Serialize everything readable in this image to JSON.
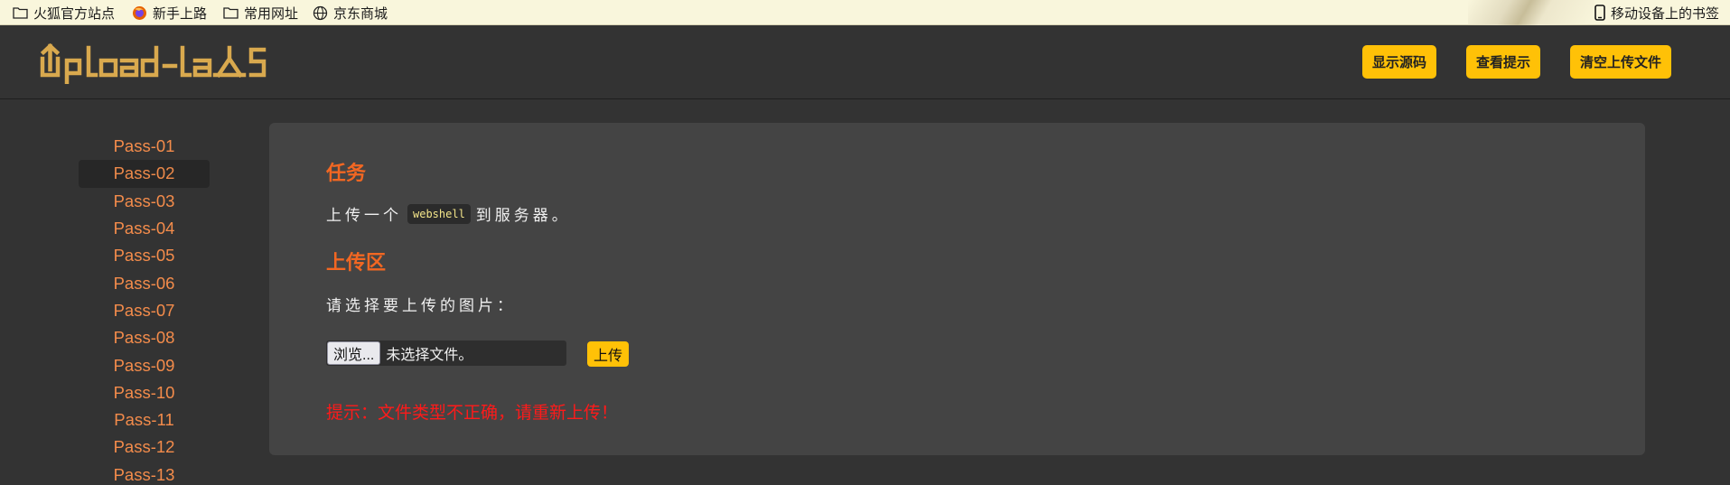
{
  "bookmarks": {
    "items": [
      {
        "label": "火狐官方站点",
        "icon": "folder-icon"
      },
      {
        "label": "新手上路",
        "icon": "firefox-icon"
      },
      {
        "label": "常用网址",
        "icon": "folder-icon"
      },
      {
        "label": "京东商城",
        "icon": "globe-icon"
      }
    ],
    "mobile": {
      "label": "移动设备上的书签",
      "icon": "mobile-icon"
    }
  },
  "header": {
    "logo_text": "Upload-labs",
    "buttons": {
      "show_source": "显示源码",
      "show_hint": "查看提示",
      "clear_uploads": "清空上传文件"
    }
  },
  "sidebar": {
    "items": [
      "Pass-01",
      "Pass-02",
      "Pass-03",
      "Pass-04",
      "Pass-05",
      "Pass-06",
      "Pass-07",
      "Pass-08",
      "Pass-09",
      "Pass-10",
      "Pass-11",
      "Pass-12",
      "Pass-13"
    ],
    "active_index": 1
  },
  "main": {
    "task_title": "任务",
    "task_prefix": "上传一个",
    "task_code": "webshell",
    "task_suffix": "到服务器。",
    "upload_title": "上传区",
    "choose_label": "请选择要上传的图片：",
    "browse_label": "浏览...",
    "file_status": "未选择文件。",
    "upload_button": "上传",
    "error_message": "提示：文件类型不正确，请重新上传！"
  },
  "colors": {
    "accent": "#ffc107",
    "link": "#f48c4b",
    "heading": "#f26722",
    "error": "#ff1a1a",
    "background": "#333333",
    "panel": "#444444"
  }
}
